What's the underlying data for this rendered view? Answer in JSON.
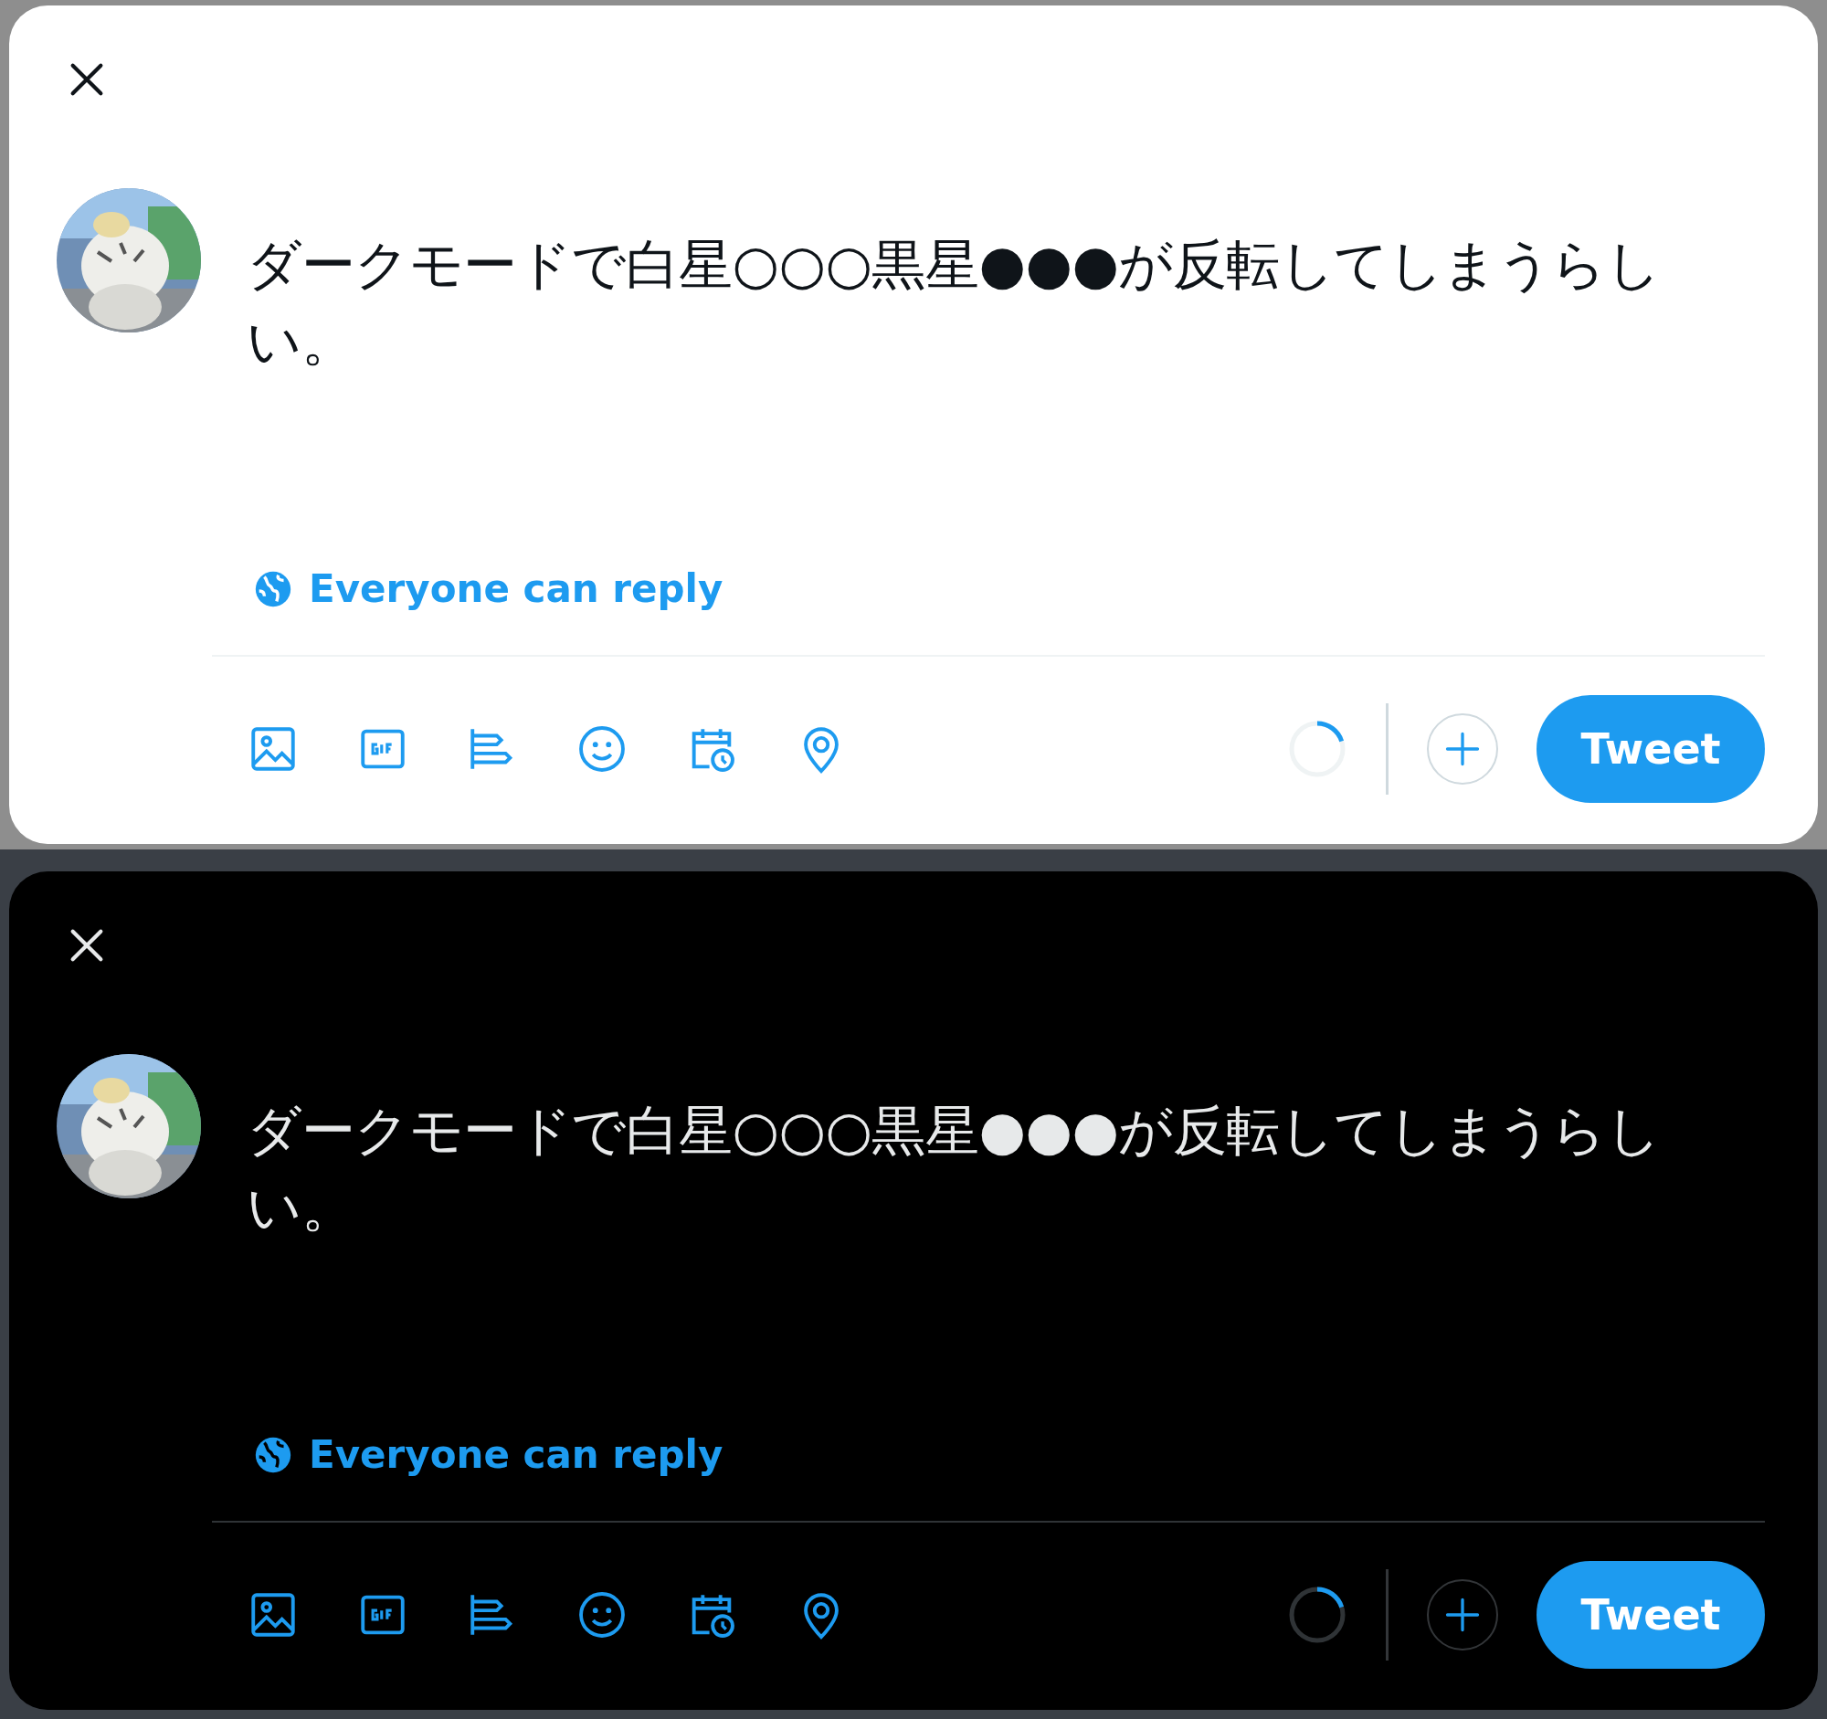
{
  "dialogs": [
    {
      "kind": "light",
      "text": "ダークモードで白星○○○黒星●●●が反転してしまうらしい。",
      "reply_setting": "Everyone can reply",
      "counter": {
        "level": 0.2
      },
      "tweet_button": "Tweet"
    },
    {
      "kind": "dark",
      "text": "ダークモードで白星○○○黒星●●●が反転してしまうらしい。",
      "reply_setting": "Everyone can reply",
      "counter": {
        "level": 0.2
      },
      "tweet_button": "Tweet"
    }
  ]
}
